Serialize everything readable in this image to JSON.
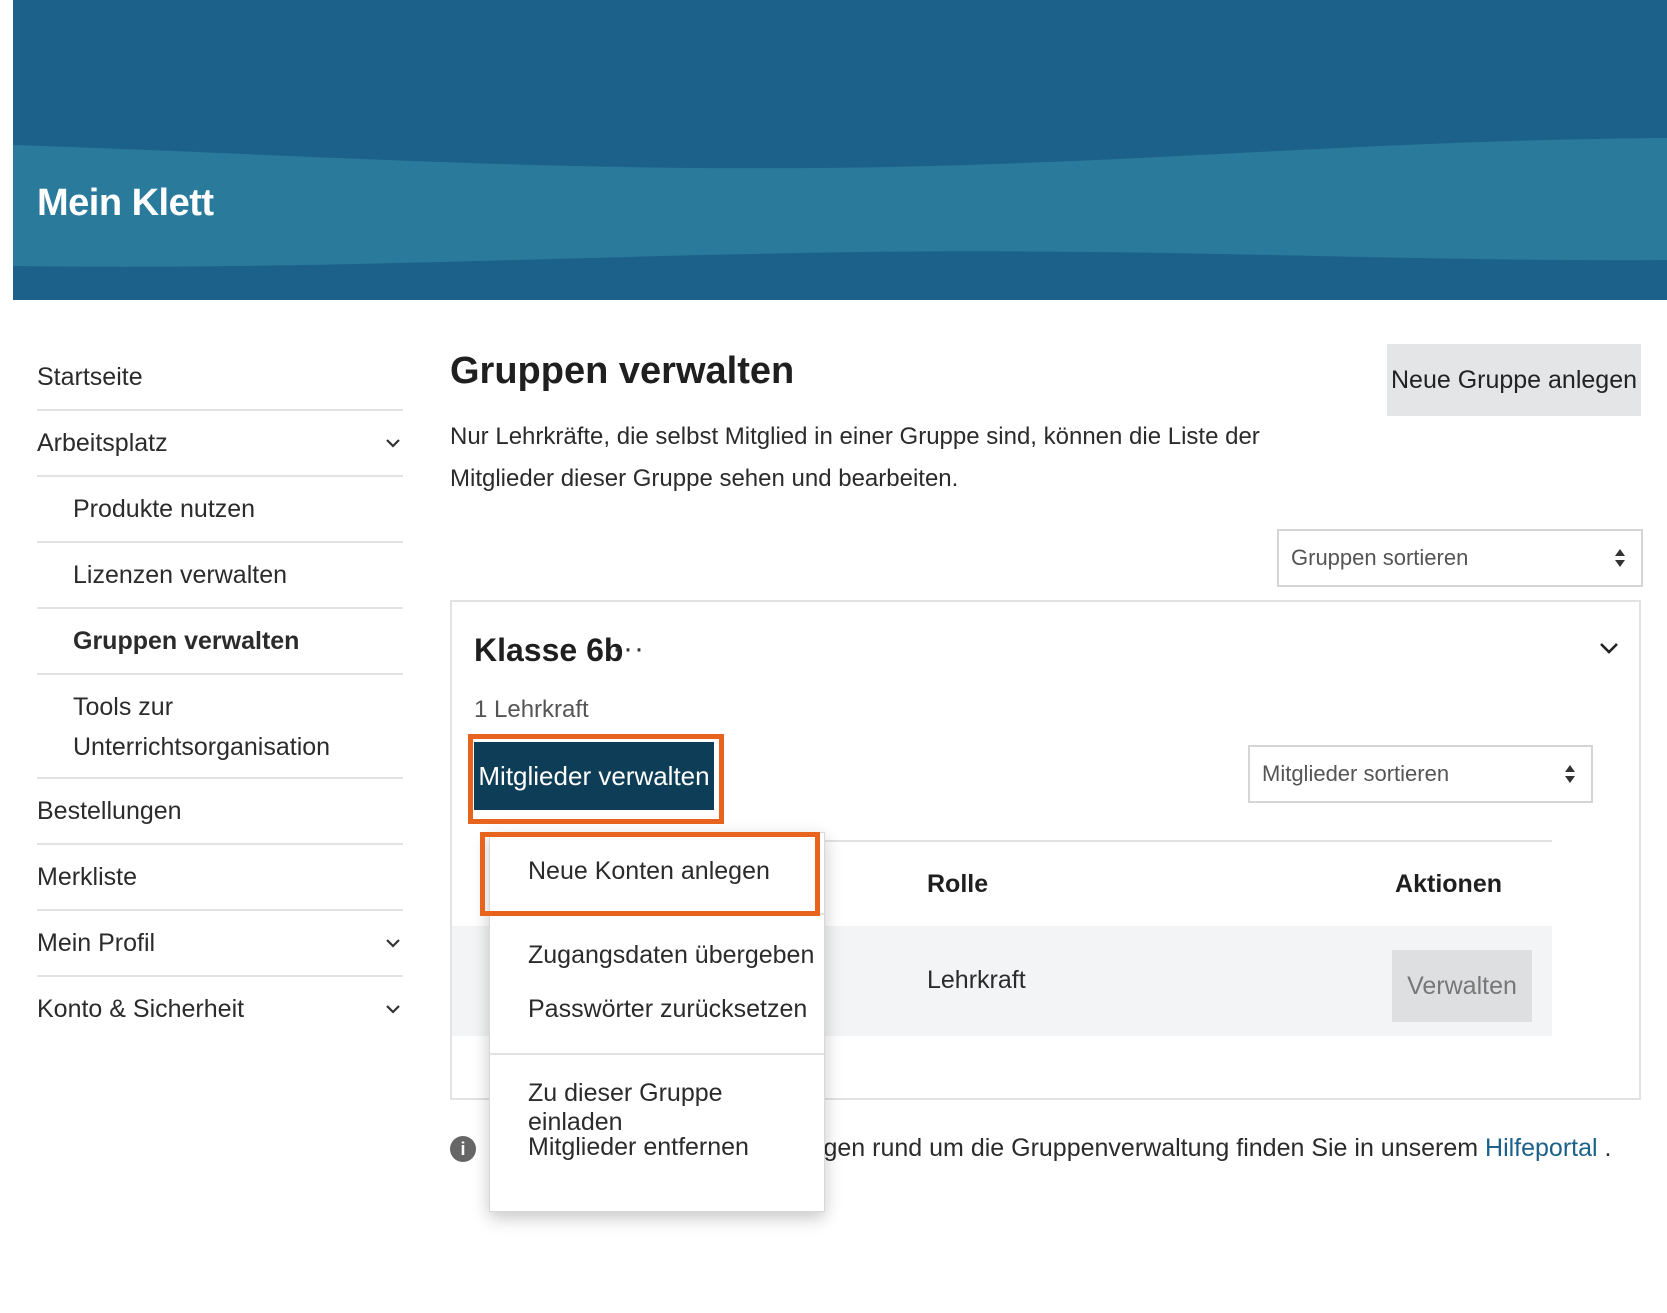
{
  "header": {
    "title": "Mein Klett"
  },
  "sidebar": {
    "items": [
      {
        "label": "Startseite"
      },
      {
        "label": "Arbeitsplatz"
      },
      {
        "label": "Produkte nutzen"
      },
      {
        "label": "Lizenzen verwalten"
      },
      {
        "label": "Gruppen verwalten"
      },
      {
        "label": "Tools zur Unterrichtsorganisation"
      },
      {
        "label": "Bestellungen"
      },
      {
        "label": "Merkliste"
      },
      {
        "label": "Mein Profil"
      },
      {
        "label": "Konto & Sicherheit"
      }
    ]
  },
  "main": {
    "title": "Gruppen verwalten",
    "new_group_label": "Neue Gruppe anlegen",
    "intro": "Nur Lehrkräfte, die selbst Mitglied in einer Gruppe sind, können die Liste der Mitglieder dieser Gruppe sehen und bearbeiten.",
    "sort_groups": "Gruppen sortieren",
    "group": {
      "name": "Klasse 6b",
      "more": "···",
      "member_count": "1 Lehrkraft",
      "manage_label": "Mitglieder verwalten",
      "sort_members": "Mitglieder sortieren",
      "table": {
        "col_role": "Rolle",
        "col_actions": "Aktionen",
        "row_role": "Lehrkraft",
        "row_action": "Verwalten"
      }
    },
    "help": {
      "icon": "i",
      "text": "Fragen rund um die Gruppenverwaltung finden Sie in unserem ",
      "link": "Hilfeportal",
      "end": " ."
    }
  },
  "dropdown": {
    "items": [
      "Neue Konten anlegen",
      "Zugangsdaten übergeben",
      "Passwörter zurücksetzen",
      "Zu dieser Gruppe einladen",
      "Mitglieder entfernen"
    ]
  },
  "colors": {
    "header_dark": "#1c6189",
    "header_wave": "#2a7a9c",
    "primary_button": "#0d3d57",
    "highlight": "#e8631e",
    "link": "#1c6189"
  }
}
